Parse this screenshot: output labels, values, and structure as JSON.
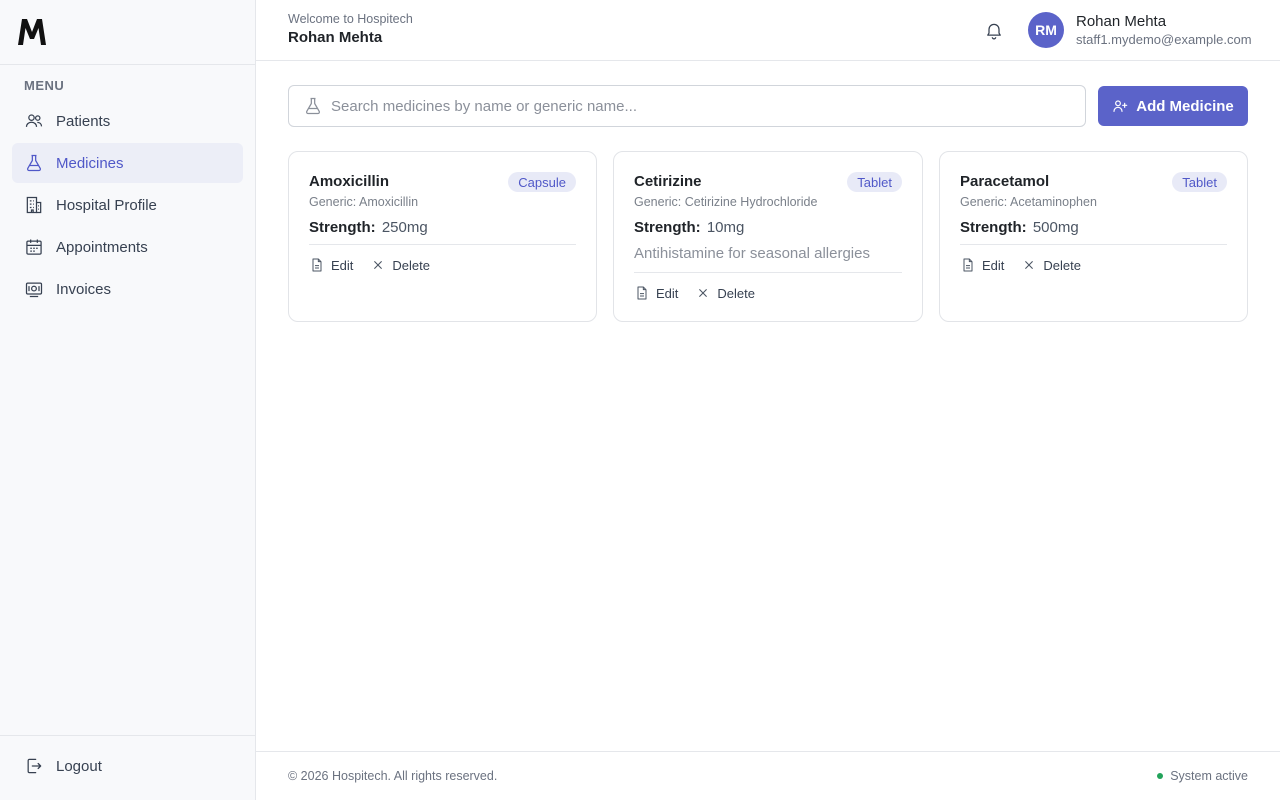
{
  "sidebar": {
    "logo_alt": "M",
    "menu_heading": "MENU",
    "items": [
      {
        "label": "Patients",
        "icon": "users-icon",
        "active": false
      },
      {
        "label": "Medicines",
        "icon": "flask-icon",
        "active": true
      },
      {
        "label": "Hospital Profile",
        "icon": "building-icon",
        "active": false
      },
      {
        "label": "Appointments",
        "icon": "calendar-icon",
        "active": false
      },
      {
        "label": "Invoices",
        "icon": "receipt-icon",
        "active": false
      }
    ],
    "logout_label": "Logout"
  },
  "header": {
    "welcome": "Welcome to Hospitech",
    "name": "Rohan Mehta",
    "user": {
      "initials": "RM",
      "name": "Rohan Mehta",
      "email": "staff1.mydemo@example.com"
    }
  },
  "toolbar": {
    "search_placeholder": "Search medicines by name or generic name...",
    "search_value": "",
    "add_label": "Add Medicine"
  },
  "medicines": [
    {
      "name": "Amoxicillin",
      "form": "Capsule",
      "generic": "Generic: Amoxicillin",
      "strength_label": "Strength:",
      "strength": "250mg",
      "description": ""
    },
    {
      "name": "Cetirizine",
      "form": "Tablet",
      "generic": "Generic: Cetirizine Hydrochloride",
      "strength_label": "Strength:",
      "strength": "10mg",
      "description": "Antihistamine for seasonal allergies"
    },
    {
      "name": "Paracetamol",
      "form": "Tablet",
      "generic": "Generic: Acetaminophen",
      "strength_label": "Strength:",
      "strength": "500mg",
      "description": ""
    }
  ],
  "card_actions": {
    "edit_label": "Edit",
    "delete_label": "Delete"
  },
  "footer": {
    "copyright": "© 2026 Hospitech. All rights reserved.",
    "status": "System active"
  },
  "colors": {
    "accent": "#5b63c9",
    "active_bg": "#eceef7",
    "status_green": "#22a35a"
  }
}
